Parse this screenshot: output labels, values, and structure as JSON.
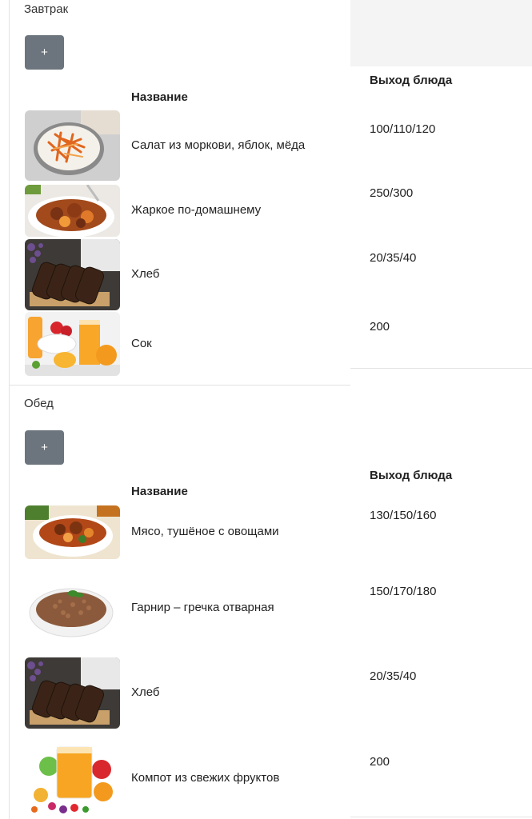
{
  "breakfast": {
    "title": "Завтрак",
    "add_label": "+",
    "col_name": "Название",
    "col_yield": "Выход блюда",
    "items": [
      {
        "name": "Салат из моркови, яблок, мёда",
        "yield": "100/110/120",
        "image": "carrot-salad-image"
      },
      {
        "name": "Жаркое по-домашнему",
        "yield": "250/300",
        "image": "stew-image"
      },
      {
        "name": "Хлеб",
        "yield": "20/35/40",
        "image": "bread-image"
      },
      {
        "name": "Сок",
        "yield": "200",
        "image": "juice-image"
      }
    ]
  },
  "lunch": {
    "title": "Обед",
    "add_label": "+",
    "col_name": "Название",
    "col_yield": "Выход блюда",
    "items": [
      {
        "name": "Мясо, тушёное с овощами",
        "yield": "130/150/160",
        "image": "meat-stew-image"
      },
      {
        "name": "Гарнир – гречка отварная",
        "yield": "150/170/180",
        "image": "buckwheat-image"
      },
      {
        "name": "Хлеб",
        "yield": "20/35/40",
        "image": "bread-image"
      },
      {
        "name": "Компот из свежих фруктов",
        "yield": "200",
        "image": "fruit-compote-image"
      }
    ]
  }
}
